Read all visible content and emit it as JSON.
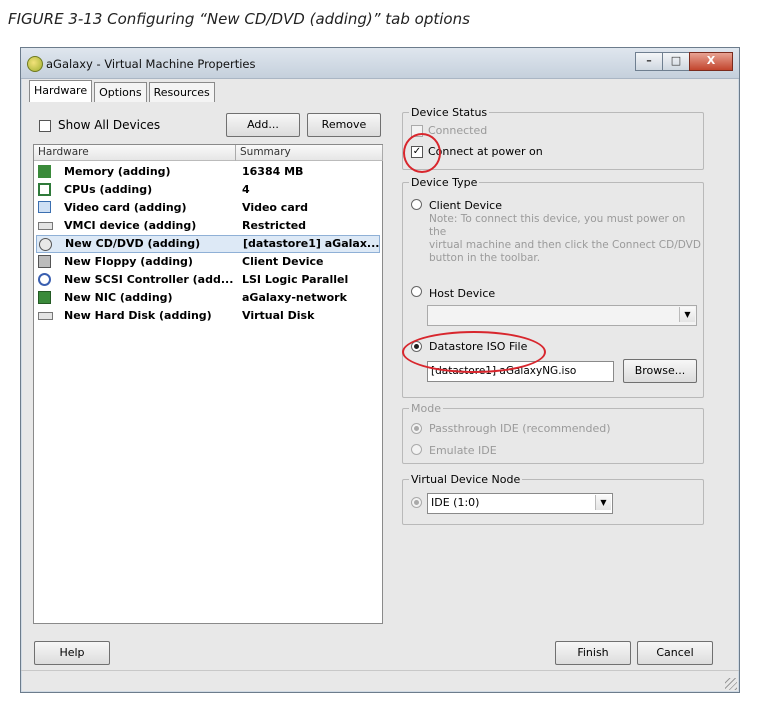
{
  "caption": "FIGURE 3-13 Configuring “New CD/DVD (adding)” tab options",
  "window": {
    "title": "aGalaxy - Virtual Machine Properties",
    "controls": {
      "minimize": "–",
      "maximize": "□",
      "close": "X"
    }
  },
  "tabs": [
    "Hardware",
    "Options",
    "Resources"
  ],
  "left": {
    "show_all_devices": "Show All Devices",
    "add_label": "Add...",
    "remove_label": "Remove",
    "columns": [
      "Hardware",
      "Summary"
    ],
    "rows": [
      {
        "name": "Memory (adding)",
        "summary": "16384 MB",
        "icon": "memory-icon",
        "color": "#3a8a3a"
      },
      {
        "name": "CPUs (adding)",
        "summary": "4",
        "icon": "cpu-icon",
        "color": "#2f7a3a"
      },
      {
        "name": "Video card  (adding)",
        "summary": "Video card",
        "icon": "monitor-icon",
        "color": "#3b6fb0"
      },
      {
        "name": "VMCI device (adding)",
        "summary": "Restricted",
        "icon": "device-icon",
        "color": "#777777"
      },
      {
        "name": "New CD/DVD (adding)",
        "summary": "[datastore1] aGalax...",
        "icon": "cd-dvd-icon",
        "color": "#555555"
      },
      {
        "name": "New Floppy (adding)",
        "summary": "Client Device",
        "icon": "floppy-icon",
        "color": "#555555"
      },
      {
        "name": "New SCSI Controller (add...",
        "summary": "LSI Logic Parallel",
        "icon": "scsi-icon",
        "color": "#3a5fb0"
      },
      {
        "name": "New NIC (adding)",
        "summary": "aGalaxy-network",
        "icon": "nic-icon",
        "color": "#3a8a3a"
      },
      {
        "name": "New Hard Disk (adding)",
        "summary": "Virtual Disk",
        "icon": "disk-icon",
        "color": "#777777"
      }
    ]
  },
  "device_status": {
    "legend": "Device Status",
    "connected": "Connected",
    "connect_at_power_on": "Connect at power on"
  },
  "device_type": {
    "legend": "Device Type",
    "client_device": "Client Device",
    "note_lines": [
      "Note: To connect this device, you must power on the",
      "virtual machine and then click the Connect CD/DVD",
      "button in the toolbar."
    ],
    "host_device": "Host Device",
    "datastore_iso": "Datastore ISO File",
    "iso_path": "[datastore1] aGalaxyNG.iso",
    "browse_label": "Browse..."
  },
  "mode": {
    "legend": "Mode",
    "passthrough": "Passthrough IDE (recommended)",
    "emulate": "Emulate IDE"
  },
  "virtual_device_node": {
    "legend": "Virtual Device Node",
    "value": "IDE (1:0)"
  },
  "footer": {
    "help_label": "Help",
    "finish_label": "Finish",
    "cancel_label": "Cancel"
  },
  "colors": {
    "highlight_circle": "#d8262d",
    "selected_row": "#dde9f6"
  }
}
